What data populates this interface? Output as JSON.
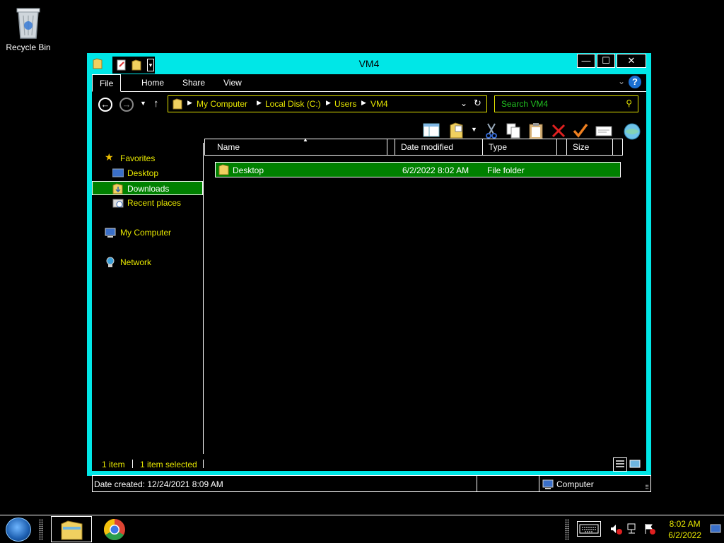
{
  "desktop": {
    "recycle_bin_label": "Recycle Bin"
  },
  "window": {
    "title": "VM4",
    "controls": {
      "minimize": "—",
      "maximize": "☐",
      "close": "✕"
    }
  },
  "ribbon": {
    "tabs": [
      "File",
      "Home",
      "Share",
      "View"
    ],
    "help_label": "?"
  },
  "address_bar": {
    "segments": [
      "My Computer",
      "Local Disk (C:)",
      "Users",
      "VM4"
    ]
  },
  "search": {
    "placeholder": "Search VM4"
  },
  "nav_pane": {
    "favorites_label": "Favorites",
    "items": [
      {
        "label": "Desktop",
        "icon": "desktop-icon"
      },
      {
        "label": "Downloads",
        "icon": "downloads-icon",
        "selected": true
      },
      {
        "label": "Recent places",
        "icon": "recent-places-icon"
      }
    ],
    "computer_label": "My Computer",
    "network_label": "Network"
  },
  "file_list": {
    "columns": [
      "Name",
      "Date modified",
      "Type",
      "Size"
    ],
    "rows": [
      {
        "name": "Desktop",
        "date_modified": "6/2/2022 8:02 AM",
        "type": "File folder",
        "size": ""
      }
    ]
  },
  "status": {
    "item_count": "1 item",
    "selected_count": "1 item selected",
    "date_created": "Date created: 12/24/2021 8:09 AM",
    "location": "Computer"
  },
  "taskbar": {
    "time": "8:02 AM",
    "date": "6/2/2022"
  },
  "colors": {
    "window_frame": "#00e7e7",
    "selection": "#008000",
    "link_text": "#e6e600",
    "search_placeholder": "#20c020"
  }
}
